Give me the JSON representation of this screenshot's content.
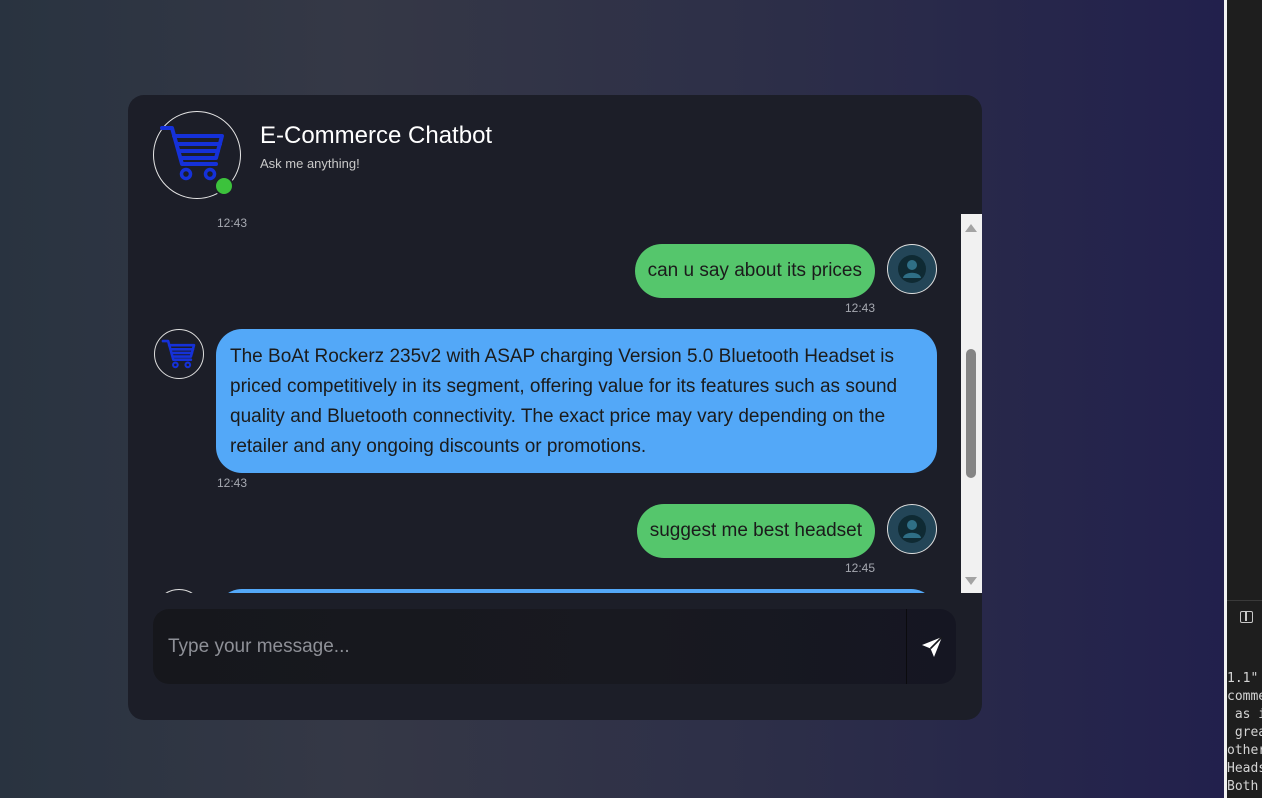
{
  "header": {
    "title": "E-Commerce Chatbot",
    "subtitle": "Ask me anything!",
    "logo_icon": "shopping-cart-icon",
    "status": "online"
  },
  "messages": [
    {
      "sender": "bot",
      "time": "12:43"
    },
    {
      "sender": "user",
      "text": "can u say about its prices",
      "time": "12:43"
    },
    {
      "sender": "bot",
      "text": "The BoAt Rockerz 235v2 with ASAP charging Version 5.0 Bluetooth Headset is priced competitively in its segment, offering value for its features such as sound quality and Bluetooth connectivity. The exact price may vary depending on the retailer and any ongoing discounts or promotions.",
      "time": "12:43"
    },
    {
      "sender": "user",
      "text": "suggest me best headset",
      "time": "12:45"
    }
  ],
  "input": {
    "placeholder": "Type your message...",
    "value": ""
  },
  "send_icon": "send-icon",
  "side_panel": {
    "icon": "split-editor-icon",
    "code_lines": [
      "1.1\"",
      "comme",
      " as i",
      " grea",
      "other",
      "Heads",
      "Both"
    ]
  },
  "colors": {
    "user_bubble": "#55c66c",
    "bot_bubble": "#53a8f8",
    "window_bg": "#1c1e28",
    "online": "#3cc23c",
    "cart_icon": "#1531d9"
  }
}
